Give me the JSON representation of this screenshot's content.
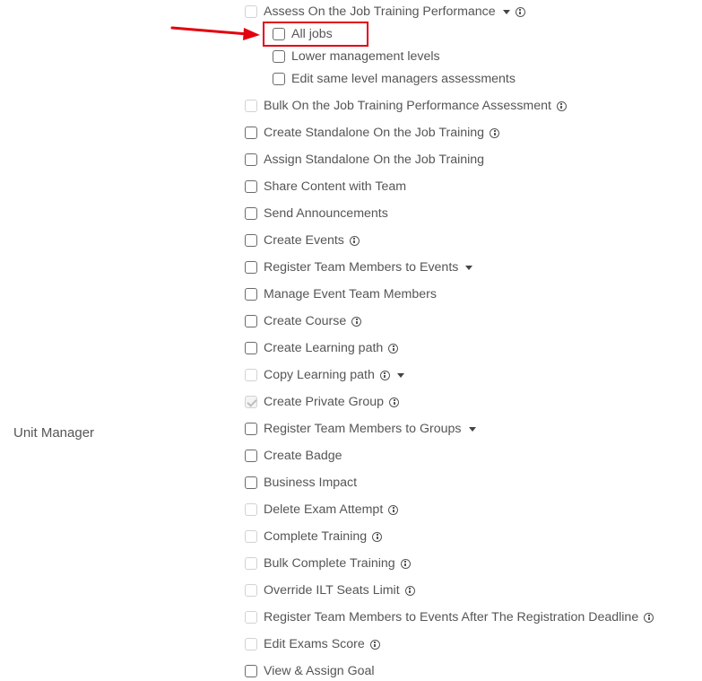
{
  "role": {
    "label": "Unit Manager"
  },
  "colors": {
    "highlight": "#e3000f",
    "text": "#555555",
    "checkbox_border": "#6b6b6b",
    "checkbox_disabled_border": "#d2d2d2"
  },
  "permissions": [
    {
      "label": "Assess On the Job Training Performance",
      "state": "disabled",
      "info": true,
      "caret": true,
      "icons": [
        "caret-down-icon",
        "info-icon"
      ]
    },
    {
      "label": "All jobs",
      "state": "unchecked",
      "sub": true,
      "highlighted": true
    },
    {
      "label": "Lower management levels",
      "state": "unchecked",
      "sub": true
    },
    {
      "label": "Edit same level managers assessments",
      "state": "unchecked",
      "sub": true
    },
    {
      "label": "Bulk On the Job Training Performance Assessment",
      "state": "disabled",
      "info": true
    },
    {
      "label": "Create Standalone On the Job Training",
      "state": "unchecked",
      "info": true
    },
    {
      "label": "Assign Standalone On the Job Training",
      "state": "unchecked"
    },
    {
      "label": "Share Content with Team",
      "state": "unchecked"
    },
    {
      "label": "Send Announcements",
      "state": "unchecked"
    },
    {
      "label": "Create Events",
      "state": "unchecked",
      "info": true
    },
    {
      "label": "Register Team Members to Events",
      "state": "unchecked",
      "caret": true
    },
    {
      "label": "Manage Event Team Members",
      "state": "unchecked"
    },
    {
      "label": "Create Course",
      "state": "unchecked",
      "info": true
    },
    {
      "label": "Create Learning path",
      "state": "unchecked",
      "info": true
    },
    {
      "label": "Copy Learning path",
      "state": "disabled",
      "info": true,
      "caret": true,
      "icons": [
        "info-icon",
        "caret-down-icon"
      ]
    },
    {
      "label": "Create Private Group",
      "state": "checked-disabled",
      "info": true
    },
    {
      "label": "Register Team Members to Groups",
      "state": "unchecked",
      "caret": true
    },
    {
      "label": "Create Badge",
      "state": "unchecked"
    },
    {
      "label": "Business Impact",
      "state": "unchecked"
    },
    {
      "label": "Delete Exam Attempt",
      "state": "disabled",
      "info": true
    },
    {
      "label": "Complete Training",
      "state": "disabled",
      "info": true
    },
    {
      "label": "Bulk Complete Training",
      "state": "disabled",
      "info": true
    },
    {
      "label": "Override ILT Seats Limit",
      "state": "disabled",
      "info": true
    },
    {
      "label": "Register Team Members to Events After The Registration Deadline",
      "state": "disabled",
      "info": true
    },
    {
      "label": "Edit Exams Score",
      "state": "disabled",
      "info": true
    },
    {
      "label": "View & Assign Goal",
      "state": "unchecked"
    }
  ]
}
